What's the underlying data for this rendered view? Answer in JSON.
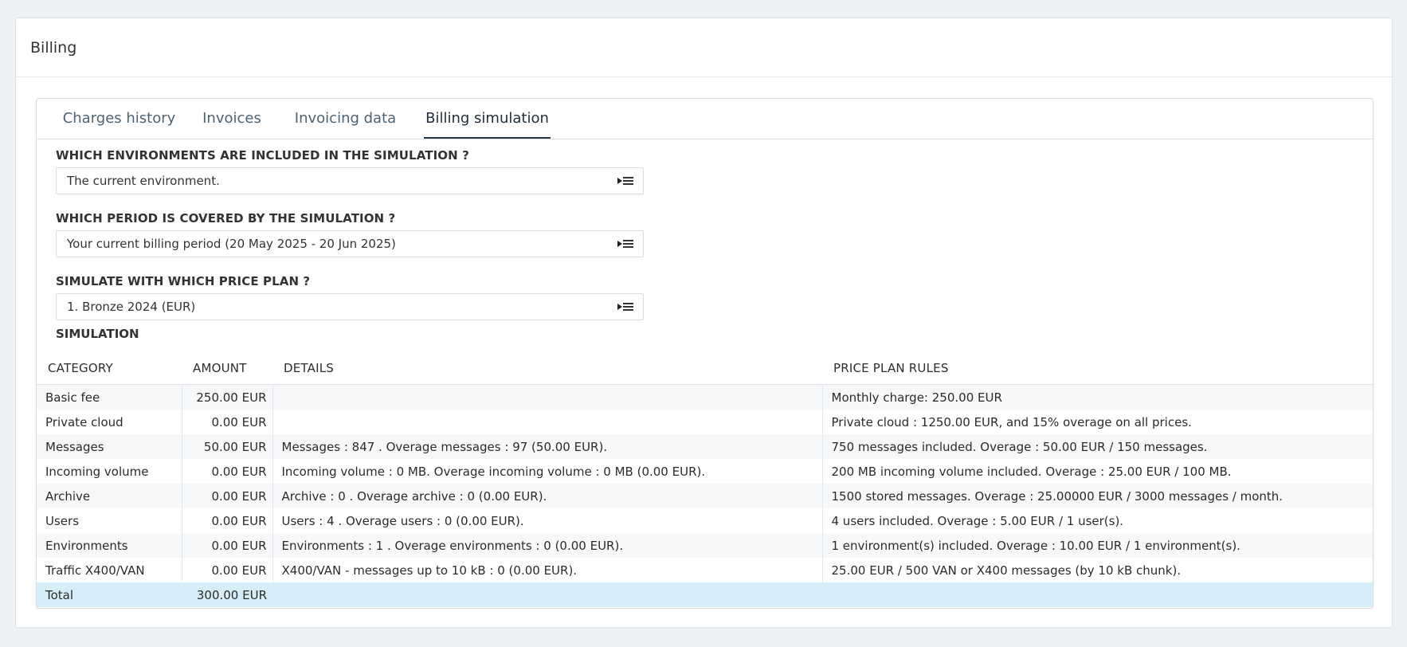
{
  "page": {
    "title": "Billing"
  },
  "tabs": [
    {
      "label": "Charges history"
    },
    {
      "label": "Invoices"
    },
    {
      "label": "Invoicing data"
    },
    {
      "label": "Billing simulation"
    }
  ],
  "form": {
    "environments": {
      "label": "WHICH ENVIRONMENTS ARE INCLUDED IN THE SIMULATION ?",
      "value": "The current environment."
    },
    "period": {
      "label": "WHICH PERIOD IS COVERED BY THE SIMULATION ?",
      "value": "Your current billing period (20 May 2025 - 20 Jun 2025)"
    },
    "price_plan": {
      "label": "SIMULATE WITH WHICH PRICE PLAN ?",
      "value": "1. Bronze 2024 (EUR)"
    }
  },
  "simulation": {
    "label": "SIMULATION",
    "headers": [
      "CATEGORY",
      "AMOUNT",
      "DETAILS",
      "PRICE PLAN RULES"
    ],
    "rows": [
      [
        "Basic fee",
        "250.00 EUR",
        "",
        "Monthly charge: 250.00 EUR"
      ],
      [
        "Private cloud",
        "0.00 EUR",
        "",
        "Private cloud : 1250.00 EUR, and 15% overage on all prices."
      ],
      [
        "Messages",
        "50.00 EUR",
        "Messages : 847 . Overage messages : 97 (50.00 EUR).",
        "750 messages included. Overage : 50.00 EUR / 150 messages."
      ],
      [
        "Incoming volume",
        "0.00 EUR",
        "Incoming volume : 0 MB. Overage incoming volume : 0 MB (0.00 EUR).",
        "200 MB incoming volume included. Overage : 25.00 EUR / 100 MB."
      ],
      [
        "Archive",
        "0.00 EUR",
        "Archive : 0 . Overage archive : 0 (0.00 EUR).",
        "1500 stored messages. Overage : 25.00000 EUR / 3000 messages / month."
      ],
      [
        "Users",
        "0.00 EUR",
        "Users : 4 . Overage users : 0 (0.00 EUR).",
        "4 users included. Overage : 5.00 EUR / 1 user(s)."
      ],
      [
        "Environments",
        "0.00 EUR",
        "Environments : 1 . Overage environments : 0 (0.00 EUR).",
        "1 environment(s) included. Overage : 10.00 EUR / 1 environment(s)."
      ],
      [
        "Traffic X400/VAN",
        "0.00 EUR",
        "X400/VAN - messages up to 10 kB : 0 (0.00 EUR).",
        "25.00 EUR / 500 VAN or X400 messages (by 10 kB chunk)."
      ]
    ],
    "total": {
      "label": "Total",
      "amount": "300.00 EUR"
    }
  }
}
